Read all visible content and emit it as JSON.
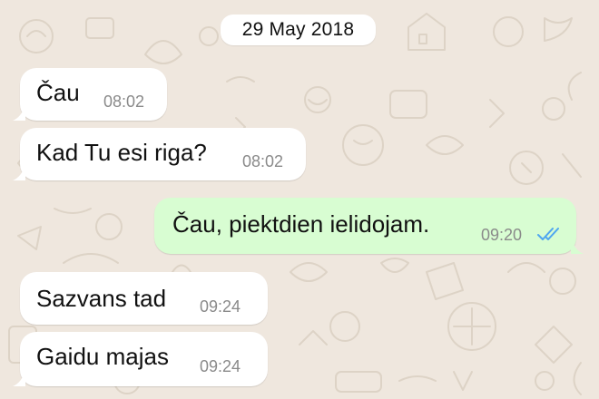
{
  "chat": {
    "date_label": "29 May 2018",
    "messages": [
      {
        "text": "Čau",
        "time": "08:02",
        "direction": "incoming"
      },
      {
        "text": "Kad Tu esi riga?",
        "time": "08:02",
        "direction": "incoming"
      },
      {
        "text": "Čau, piektdien ielidojam.",
        "time": "09:20",
        "direction": "outgoing",
        "status": "read-double-check-icon"
      },
      {
        "text": "Sazvans tad",
        "time": "09:24",
        "direction": "incoming"
      },
      {
        "text": "Gaidu majas",
        "time": "09:24",
        "direction": "incoming"
      }
    ]
  },
  "colors": {
    "background": "#efe7de",
    "incoming_bubble": "#ffffff",
    "outgoing_bubble": "#d8fdd2",
    "timestamp": "#8a8a8a",
    "read_ticks": "#4fa6f0"
  }
}
